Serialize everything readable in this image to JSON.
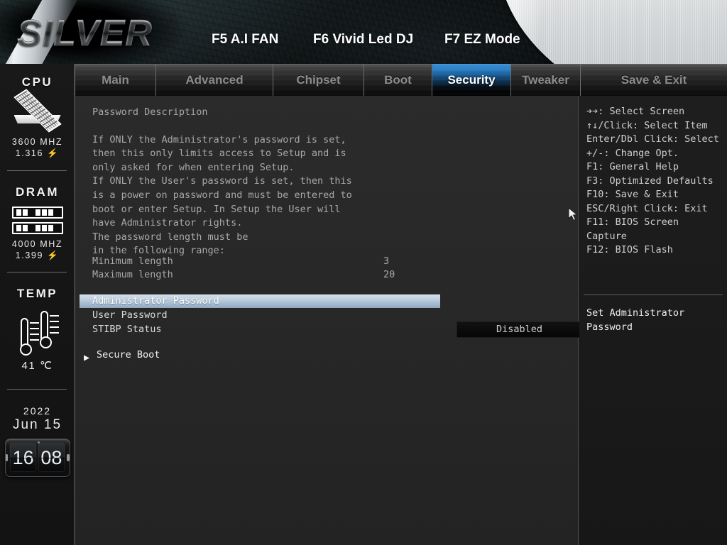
{
  "header": {
    "logo_text": "SILVER",
    "function_keys": [
      {
        "name": "f5",
        "label": "F5 A.I FAN"
      },
      {
        "name": "f6",
        "label": "F6 Vivid Led DJ"
      },
      {
        "name": "f7",
        "label": "F7 EZ Mode"
      }
    ]
  },
  "tabs": [
    {
      "id": "main",
      "label": "Main",
      "active": false
    },
    {
      "id": "advanced",
      "label": "Advanced",
      "active": false
    },
    {
      "id": "chipset",
      "label": "Chipset",
      "active": false
    },
    {
      "id": "boot",
      "label": "Boot",
      "active": false
    },
    {
      "id": "security",
      "label": "Security",
      "active": true
    },
    {
      "id": "tweaker",
      "label": "Tweaker",
      "active": false
    },
    {
      "id": "saveexit",
      "label": "Save & Exit",
      "active": false
    }
  ],
  "sidebar": {
    "cpu": {
      "title": "CPU",
      "icon": "cpu-chip-icon",
      "frequency": "3600 MHZ",
      "voltage": "1.316 ⚡"
    },
    "dram": {
      "title": "DRAM",
      "icon": "memory-module-icon",
      "frequency": "4000 MHZ",
      "voltage": "1.399 ⚡"
    },
    "temp": {
      "title": "TEMP",
      "icon": "thermometer-icon",
      "value": "41 ℃"
    },
    "datetime": {
      "year": "2022",
      "month_day": "Jun  15",
      "hours": "16",
      "minutes": "08"
    }
  },
  "main": {
    "description_heading": "Password Description",
    "description_body": "If ONLY the Administrator's password is set,\nthen this only limits access to Setup and is\nonly asked for when entering Setup.\nIf ONLY the User's password is set, then this\nis a power on password and must be entered to\nboot or enter Setup. In Setup the User will\nhave Administrator rights.\nThe password length must be\nin the following range:",
    "length_rows": [
      {
        "key": "Minimum length",
        "value": "3"
      },
      {
        "key": "Maximum length",
        "value": "20"
      }
    ],
    "options": [
      {
        "id": "admin-password",
        "label": "Administrator Password",
        "value": "",
        "selected": true
      },
      {
        "id": "user-password",
        "label": "User Password",
        "value": "",
        "selected": false
      },
      {
        "id": "stibp-status",
        "label": "STIBP Status",
        "value": "Disabled",
        "selected": false
      }
    ],
    "submenu": {
      "id": "secure-boot",
      "arrow": "▶",
      "label": "Secure Boot"
    }
  },
  "help": {
    "keys_text": "➔➔: Select Screen\n↑↓/Click: Select Item\nEnter/Dbl Click: Select\n+/-: Change Opt.\nF1: General Help\nF3: Optimized Defaults\nF10: Save & Exit\nESC/Right Click: Exit\nF11: BIOS Screen\nCapture\nF12: BIOS Flash",
    "context_text": "Set Administrator\nPassword"
  },
  "colors": {
    "accent_blue": "#2a7ec4",
    "highlight_row": "#bccddd",
    "text_dim": "#a8a8a8",
    "text_bright": "#f0f0f0"
  }
}
